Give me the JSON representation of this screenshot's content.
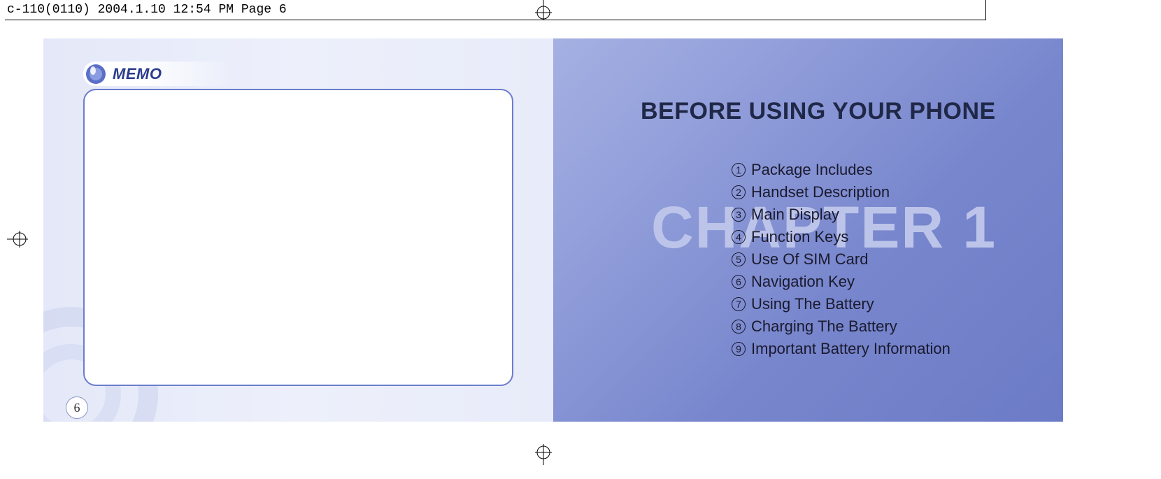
{
  "header_line": "c-110(0110)  2004.1.10  12:54 PM  Page 6",
  "left_page": {
    "memo_label": "MEMO",
    "page_number": "6"
  },
  "right_page": {
    "title": "BEFORE USING YOUR PHONE",
    "chapter_bg": "CHAPTER 1",
    "toc": [
      "Package Includes",
      "Handset Description",
      "Main Display",
      "Function Keys",
      "Use Of SIM Card",
      "Navigation Key",
      "Using The Battery",
      "Charging The Battery",
      "Important Battery Information"
    ]
  }
}
